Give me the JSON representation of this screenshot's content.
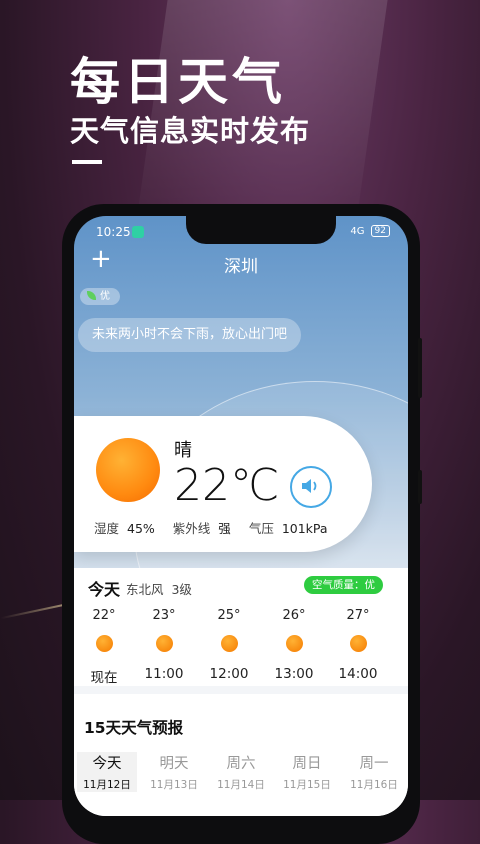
{
  "promo": {
    "title": "每日天气",
    "subtitle": "天气信息实时发布"
  },
  "status_bar": {
    "time": "10:25",
    "signal": "4G",
    "battery": "92"
  },
  "header": {
    "add_icon": "plus-icon",
    "city": "深圳"
  },
  "aqi_pill": {
    "label": "优"
  },
  "tip": "未来两小时不会下雨，放心出门吧",
  "current": {
    "condition": "晴",
    "temperature": "22℃",
    "humidity_label": "湿度",
    "humidity": "45%",
    "uv_label": "紫外线",
    "uv": "强",
    "pressure_label": "气压",
    "pressure": "101kPa"
  },
  "today": {
    "label": "今天",
    "wind": "东北风",
    "wind_level": "3级",
    "air_quality": "空气质量：优",
    "hours": [
      {
        "temp": "22°",
        "time": "现在"
      },
      {
        "temp": "23°",
        "time": "11:00"
      },
      {
        "temp": "25°",
        "time": "12:00"
      },
      {
        "temp": "26°",
        "time": "13:00"
      },
      {
        "temp": "27°",
        "time": "14:00"
      }
    ]
  },
  "forecast": {
    "title": "15天天气预报",
    "days": [
      {
        "name": "今天",
        "date": "11月12日"
      },
      {
        "name": "明天",
        "date": "11月13日"
      },
      {
        "name": "周六",
        "date": "11月14日"
      },
      {
        "name": "周日",
        "date": "11月15日"
      },
      {
        "name": "周一",
        "date": "11月16日"
      }
    ]
  },
  "colors": {
    "accent_blue": "#45a8e5",
    "sun_orange": "#ff8a10",
    "aq_green": "#2ecc40"
  }
}
